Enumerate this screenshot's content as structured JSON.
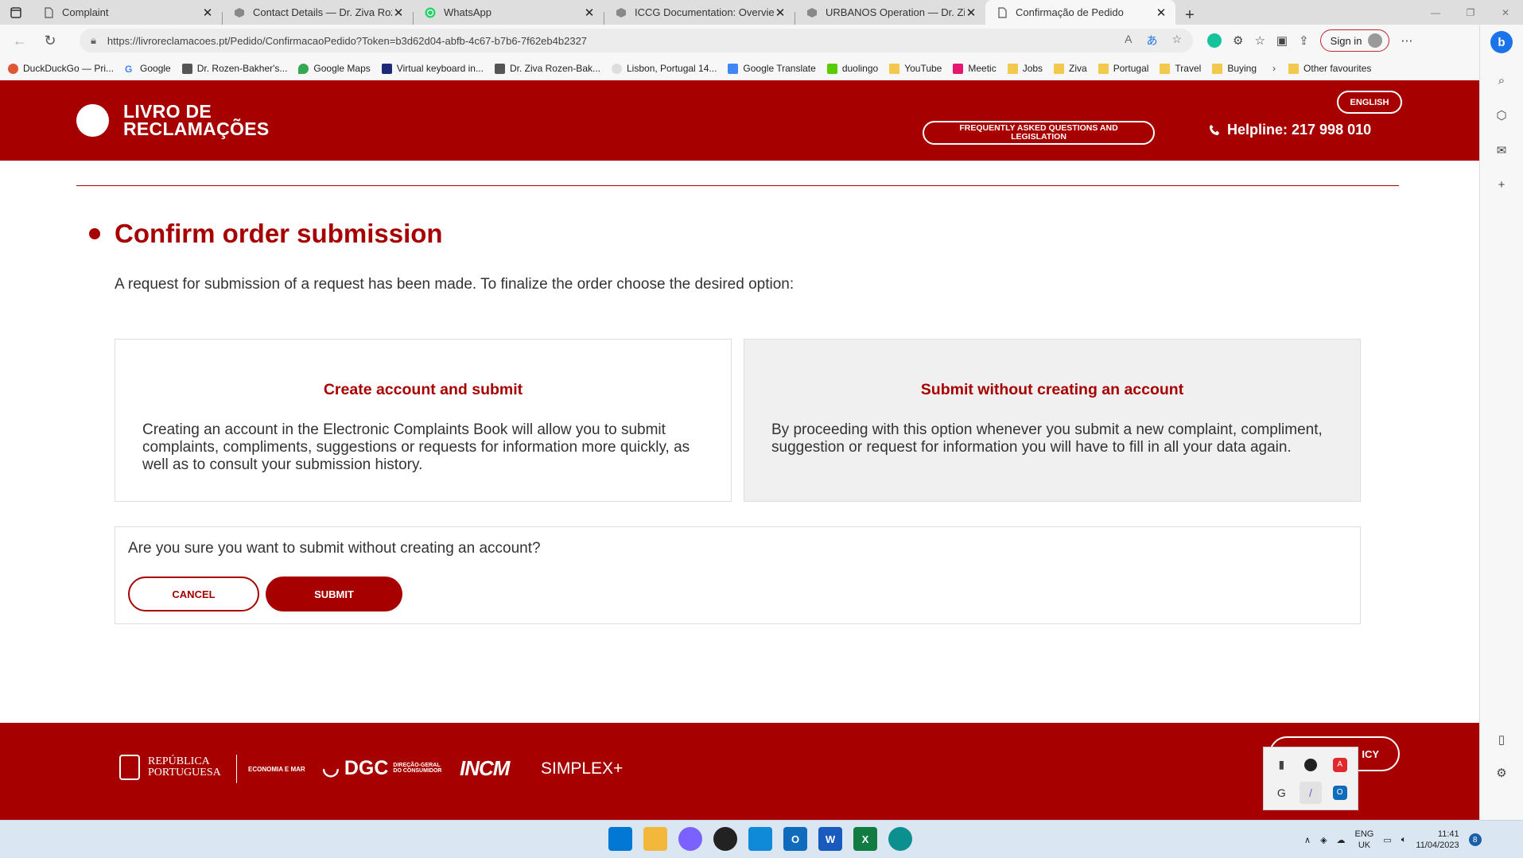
{
  "browser": {
    "tabs": [
      {
        "title": "Complaint",
        "active": false
      },
      {
        "title": "Contact Details — Dr. Ziva Rozen",
        "active": false
      },
      {
        "title": "WhatsApp",
        "active": false
      },
      {
        "title": "ICCG Documentation: Overview a",
        "active": false
      },
      {
        "title": "URBANOS Operation — Dr. Ziva",
        "active": false
      },
      {
        "title": "Confirmação de Pedido",
        "active": true
      }
    ],
    "url": "https://livroreclamacoes.pt/Pedido/ConfirmacaoPedido?Token=b3d62d04-abfb-4c67-b7b6-7f62eb4b2327",
    "sign_in": "Sign in",
    "bookmarks": [
      "DuckDuckGo — Pri...",
      "Google",
      "Dr. Rozen-Bakher's...",
      "Google Maps",
      "Virtual keyboard in...",
      "Dr. Ziva Rozen-Bak...",
      "Lisbon, Portugal 14...",
      "Google Translate",
      "duolingo",
      "YouTube",
      "Meetic",
      "Jobs",
      "Ziva",
      "Portugal",
      "Travel",
      "Buying"
    ],
    "other_favourites": "Other favourites"
  },
  "header": {
    "logo_line1": "LIVRO DE",
    "logo_line2": "RECLAMAÇÕES",
    "english": "ENGLISH",
    "faq": "FREQUENTLY ASKED QUESTIONS AND LEGISLATION",
    "helpline": "Helpline: 217 998 010"
  },
  "main": {
    "title": "Confirm order submission",
    "intro": "A request for submission of a request has been made. To finalize the order choose the desired option:",
    "card_account": {
      "title": "Create account and submit",
      "text": "Creating an account in the Electronic Complaints Book will allow you to submit complaints, compliments, suggestions or requests for information more quickly, as well as to consult your submission history."
    },
    "card_no_account": {
      "title": "Submit without creating an account",
      "text": "By proceeding with this option whenever you submit a new complaint, compliment, suggestion or request for information you will have to fill in all your data again."
    },
    "confirm_question": "Are you sure you want to submit without creating an account?",
    "cancel": "CANCEL",
    "submit": "SUBMIT"
  },
  "footer": {
    "republica_line1": "REPÚBLICA",
    "republica_line2": "PORTUGUESA",
    "economia": "ECONOMIA E MAR",
    "dgc": "DGC",
    "dgc_sub1": "DIREÇÃO-GERAL",
    "dgc_sub2": "DO CONSUMIDOR",
    "incm": "INCM",
    "simplex": "SIMPLEX+",
    "policy": "ICY"
  },
  "taskbar": {
    "lang1": "ENG",
    "lang2": "UK",
    "time": "11:41",
    "date": "11/04/2023",
    "badge": "8"
  },
  "colors": {
    "brand": "#a70000"
  }
}
